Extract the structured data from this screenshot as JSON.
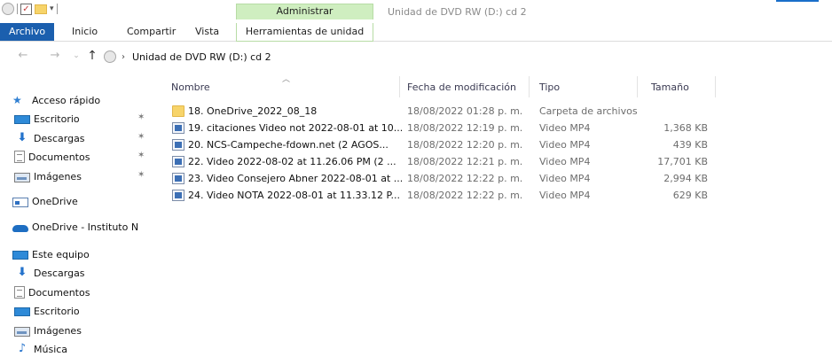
{
  "titlebar": {
    "context_group": "Administrar",
    "window_title": "Unidad de DVD RW (D:) cd 2"
  },
  "ribbon": {
    "tabs": {
      "archivo": "Archivo",
      "inicio": "Inicio",
      "compartir": "Compartir",
      "vista": "Vista",
      "herramientas": "Herramientas de unidad"
    }
  },
  "address": {
    "path": "Unidad de DVD RW (D:) cd 2"
  },
  "sidebar": {
    "items": [
      {
        "label": "Acceso rápido",
        "icon": "star-icon",
        "pinned": false
      },
      {
        "label": "Escritorio",
        "icon": "desktop-icon",
        "pinned": true
      },
      {
        "label": "Descargas",
        "icon": "download-icon",
        "pinned": true
      },
      {
        "label": "Documentos",
        "icon": "document-icon",
        "pinned": true
      },
      {
        "label": "Imágenes",
        "icon": "pictures-icon",
        "pinned": true
      },
      {
        "label": "OneDrive",
        "icon": "onedrive-icon",
        "pinned": false
      },
      {
        "label": "OneDrive - Instituto N",
        "icon": "cloud-icon",
        "pinned": false
      },
      {
        "label": "Este equipo",
        "icon": "computer-icon",
        "pinned": false
      },
      {
        "label": "Descargas",
        "icon": "download-icon",
        "pinned": false
      },
      {
        "label": "Documentos",
        "icon": "document-icon",
        "pinned": false
      },
      {
        "label": "Escritorio",
        "icon": "desktop-icon",
        "pinned": false
      },
      {
        "label": "Imágenes",
        "icon": "pictures-icon",
        "pinned": false
      },
      {
        "label": "Música",
        "icon": "music-icon",
        "pinned": false
      }
    ],
    "pin_glyph": "★"
  },
  "columns": {
    "name": "Nombre",
    "date": "Fecha de modificación",
    "type": "Tipo",
    "size": "Tamaño"
  },
  "files": [
    {
      "name": "18. OneDrive_2022_08_18",
      "date": "18/08/2022 01:28 p. m.",
      "type": "Carpeta de archivos",
      "size": "",
      "icon": "folder-icon"
    },
    {
      "name": "19. citaciones  Video not 2022-08-01 at 10...",
      "date": "18/08/2022 12:19 p. m.",
      "type": "Video MP4",
      "size": "1,368 KB",
      "icon": "video-file-icon"
    },
    {
      "name": "20. NCS-Campeche-fdown.net  (2 AGOS...",
      "date": "18/08/2022 12:20 p. m.",
      "type": "Video MP4",
      "size": "439 KB",
      "icon": "video-file-icon"
    },
    {
      "name": "22. Video 2022-08-02 at 11.26.06 PM  (2 ...",
      "date": "18/08/2022 12:21 p. m.",
      "type": "Video MP4",
      "size": "17,701 KB",
      "icon": "video-file-icon"
    },
    {
      "name": "23. Video Consejero Abner 2022-08-01 at ...",
      "date": "18/08/2022 12:22 p. m.",
      "type": "Video MP4",
      "size": "2,994 KB",
      "icon": "video-file-icon"
    },
    {
      "name": "24. Video NOTA 2022-08-01 at 11.33.12 P...",
      "date": "18/08/2022 12:22 p. m.",
      "type": "Video MP4",
      "size": "629 KB",
      "icon": "video-file-icon"
    }
  ]
}
